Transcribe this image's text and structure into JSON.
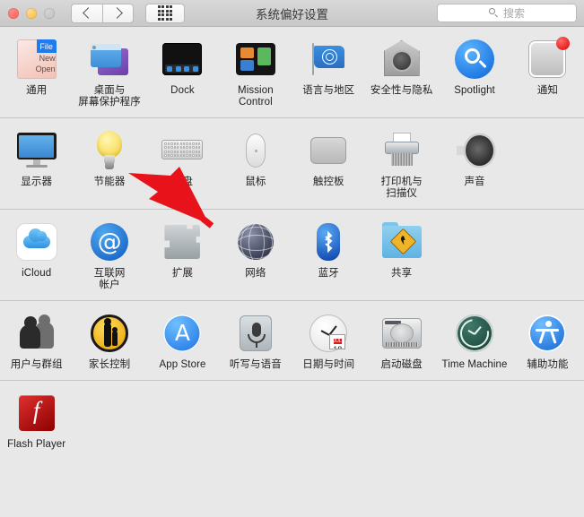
{
  "window": {
    "title": "系统偏好设置",
    "traffic_lights": [
      "close",
      "minimize",
      "zoom"
    ],
    "nav": {
      "back": "‹",
      "forward": "›",
      "show_all": "grid-icon"
    },
    "search": {
      "placeholder": "搜索",
      "value": ""
    }
  },
  "rows": [
    {
      "items": [
        {
          "label": "通用",
          "icon": "general-icon"
        },
        {
          "label": "桌面与\n屏幕保护程序",
          "label_line1": "桌面与",
          "label_line2": "屏幕保护程序",
          "icon": "desktop-screensaver-icon"
        },
        {
          "label": "Dock",
          "icon": "dock-icon"
        },
        {
          "label": "Mission Control",
          "label_line1": "Mission",
          "label_line2": "Control",
          "icon": "mission-control-icon"
        },
        {
          "label": "语言与地区",
          "icon": "language-region-icon"
        },
        {
          "label": "安全性与隐私",
          "icon": "security-privacy-icon"
        },
        {
          "label": "Spotlight",
          "icon": "spotlight-icon"
        },
        {
          "label": "通知",
          "icon": "notifications-icon"
        }
      ]
    },
    {
      "items": [
        {
          "label": "显示器",
          "icon": "displays-icon"
        },
        {
          "label": "节能器",
          "icon": "energy-saver-icon"
        },
        {
          "label": "键盘",
          "icon": "keyboard-icon"
        },
        {
          "label": "鼠标",
          "icon": "mouse-icon"
        },
        {
          "label": "触控板",
          "icon": "trackpad-icon"
        },
        {
          "label": "打印机与\n扫描仪",
          "label_line1": "打印机与",
          "label_line2": "扫描仪",
          "icon": "printers-scanners-icon"
        },
        {
          "label": "声音",
          "icon": "sound-icon"
        }
      ]
    },
    {
      "items": [
        {
          "label": "iCloud",
          "icon": "icloud-icon"
        },
        {
          "label": "互联网\n帐户",
          "label_line1": "互联网",
          "label_line2": "帐户",
          "icon": "internet-accounts-icon"
        },
        {
          "label": "扩展",
          "icon": "extensions-icon"
        },
        {
          "label": "网络",
          "icon": "network-icon"
        },
        {
          "label": "蓝牙",
          "icon": "bluetooth-icon"
        },
        {
          "label": "共享",
          "icon": "sharing-icon"
        }
      ]
    },
    {
      "items": [
        {
          "label": "用户与群组",
          "icon": "users-groups-icon"
        },
        {
          "label": "家长控制",
          "icon": "parental-controls-icon"
        },
        {
          "label": "App Store",
          "icon": "app-store-icon"
        },
        {
          "label": "听写与语音",
          "icon": "dictation-speech-icon"
        },
        {
          "label": "日期与时间",
          "icon": "date-time-icon",
          "calendar_month": "JUL",
          "calendar_day": "18"
        },
        {
          "label": "启动磁盘",
          "icon": "startup-disk-icon"
        },
        {
          "label": "Time Machine",
          "icon": "time-machine-icon"
        },
        {
          "label": "辅助功能",
          "icon": "accessibility-icon"
        }
      ]
    },
    {
      "items": [
        {
          "label": "Flash Player",
          "icon": "flash-player-icon"
        }
      ]
    }
  ],
  "annotation": {
    "type": "arrow",
    "color": "#e8131a",
    "points_at": "节能器"
  },
  "colors": {
    "window_background": "#e8e8e8",
    "titlebar": "#d0d0d0",
    "separator": "#c5c5c5",
    "label_text": "#222222",
    "close_light": "#ff5f57",
    "minimize_light": "#febc2e",
    "zoom_light": "#c4c4c4",
    "annotation_red": "#e8131a"
  }
}
